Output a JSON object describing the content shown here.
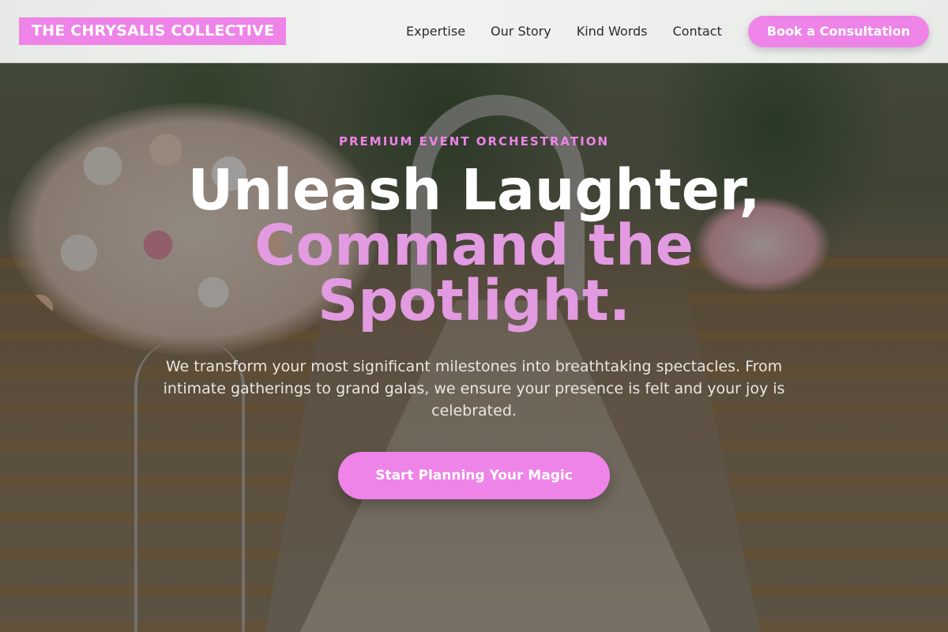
{
  "brand": {
    "name": "THE CHRYSALIS COLLECTIVE"
  },
  "nav": {
    "links": [
      "Expertise",
      "Our Story",
      "Kind Words",
      "Contact"
    ],
    "cta_label": "Book a Consultation"
  },
  "hero": {
    "eyebrow": "PREMIUM EVENT ORCHESTRATION",
    "headline_line1": "Unleash Laughter,",
    "headline_line2": "Command the",
    "headline_line3": "Spotlight.",
    "description": "We transform your most significant milestones into breathtaking spectacles. From intimate gatherings to grand galas, we ensure your presence is felt and your joy is celebrated.",
    "cta_label": "Start Planning Your Magic"
  },
  "colors": {
    "accent": "#ee84e8",
    "headline_accent": "#e29ae0",
    "header_bg": "#eeefed",
    "text_dark": "#2b2b2b"
  }
}
